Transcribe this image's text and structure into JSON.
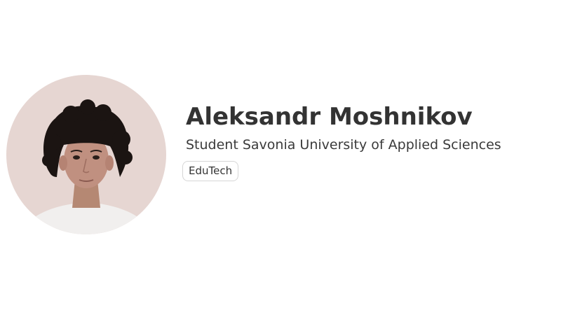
{
  "profile": {
    "name": "Aleksandr Moshnikov",
    "subtitle": "Student Savonia University of Applied Sciences",
    "tags": [
      "EduTech"
    ],
    "avatar_icon": "profile-photo"
  },
  "colors": {
    "background": "#ffffff",
    "name_text": "#333333",
    "subtitle_text": "#3a3a3a",
    "tag_border": "#d6d6d6"
  }
}
